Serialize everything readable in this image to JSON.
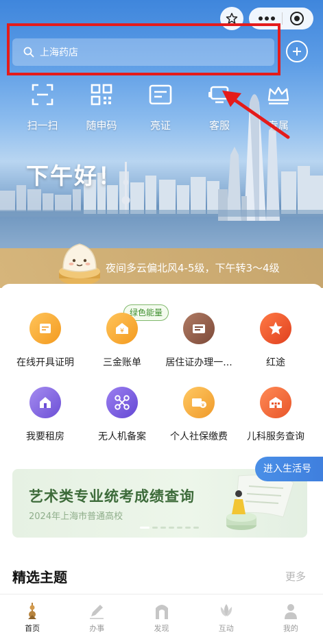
{
  "search": {
    "placeholder": "上海药店"
  },
  "quick_actions": [
    {
      "label": "扫一扫",
      "icon": "scan-icon"
    },
    {
      "label": "随申码",
      "icon": "qr-code-icon"
    },
    {
      "label": "亮证",
      "icon": "id-card-icon"
    },
    {
      "label": "客服",
      "icon": "customer-service-icon"
    },
    {
      "label": "专属",
      "icon": "crown-icon"
    }
  ],
  "greeting": "下午好！",
  "weather": "夜间多云偏北风4-5级，下午转3～4级",
  "services": [
    {
      "label": "在线开具证明",
      "icon": "certificate-icon",
      "color": "#f5a12d"
    },
    {
      "label": "三金账单",
      "icon": "house-yuan-icon",
      "color": "#f5a12d"
    },
    {
      "label": "居住证办理一...",
      "icon": "residence-card-icon",
      "color": "#8d5a48"
    },
    {
      "label": "红途",
      "icon": "red-star-icon",
      "color": "#e9532b"
    },
    {
      "label": "我要租房",
      "icon": "rent-house-icon",
      "color": "#8a67e0"
    },
    {
      "label": "无人机备案",
      "icon": "drone-icon",
      "color": "#7b5fdc"
    },
    {
      "label": "个人社保缴费",
      "icon": "social-security-icon",
      "color": "#f0a53a"
    },
    {
      "label": "儿科服务查询",
      "icon": "pediatric-icon",
      "color": "#ef6e3a"
    }
  ],
  "badge": "绿色能量",
  "enter_life": "进入生活号",
  "banner": {
    "title": "艺术类专业统考成绩查询",
    "subtitle": "2024年上海市普通高校"
  },
  "section": {
    "title": "精选主题",
    "more": "更多"
  },
  "tabs": [
    {
      "label": "首页",
      "icon": "home-tower-icon"
    },
    {
      "label": "办事",
      "icon": "pen-icon"
    },
    {
      "label": "发现",
      "icon": "arch-icon"
    },
    {
      "label": "互动",
      "icon": "magnolia-icon"
    },
    {
      "label": "我的",
      "icon": "person-icon"
    }
  ],
  "colors": {
    "highlight": "#e41b1b",
    "accent": "#3f7fde",
    "weather_bar": "#d4ae70"
  }
}
